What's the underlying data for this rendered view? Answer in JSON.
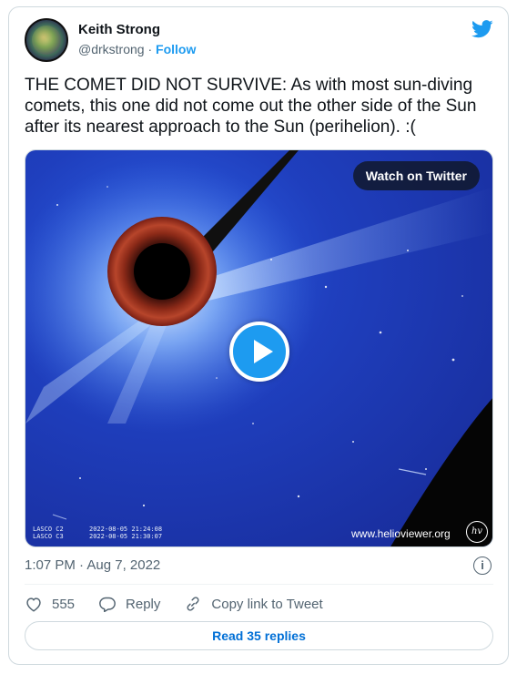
{
  "author": {
    "name": "Keith Strong",
    "handle": "@drkstrong",
    "separator": "·",
    "follow_label": "Follow",
    "avatar": "sun-avatar-image"
  },
  "brand_icon": "twitter-bird-icon",
  "tweet": {
    "text": "THE COMET DID NOT SURVIVE: As with most sun-diving comets, this one did not come out the other side of the Sun after its nearest approach to the Sun (perihelion). :(",
    "timestamp": "1:07 PM · Aug 7, 2022"
  },
  "media": {
    "watch_label": "Watch on Twitter",
    "instrument_lines": [
      "LASCO C2",
      "LASCO C3"
    ],
    "date_lines": [
      "2022-08-05 21:24:08",
      "2022-08-05 21:30:07"
    ],
    "credit": "www.helioviewer.org",
    "credit_logo": "hv"
  },
  "actions": {
    "like_count": "555",
    "reply_label": "Reply",
    "copy_label": "Copy link to Tweet"
  },
  "read_replies_label": "Read 35 replies",
  "colors": {
    "accent": "#1d9bf0",
    "link": "#006fd6",
    "muted": "#536471",
    "border": "#cfd9de"
  }
}
